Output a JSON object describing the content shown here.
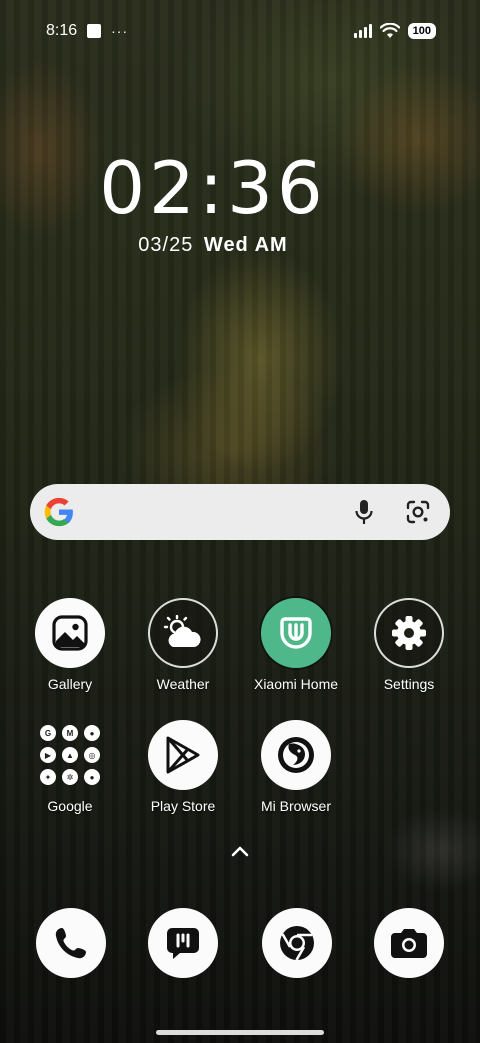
{
  "status_bar": {
    "time": "8:16",
    "more": "···",
    "battery": "100"
  },
  "clock": {
    "time": "02:36",
    "date": "03/25",
    "day": "Wed AM"
  },
  "search_bar": {
    "logo_icon": "google-g-icon",
    "mic_icon": "microphone-icon",
    "lens_icon": "google-lens-icon"
  },
  "apps": [
    {
      "label": "Gallery",
      "icon": "gallery-icon"
    },
    {
      "label": "Weather",
      "icon": "weather-icon"
    },
    {
      "label": "Xiaomi Home",
      "icon": "xiaomi-home-icon"
    },
    {
      "label": "Settings",
      "icon": "gear-icon"
    },
    {
      "label": "Google",
      "icon": "google-folder-icon"
    },
    {
      "label": "Play Store",
      "icon": "play-store-icon"
    },
    {
      "label": "Mi Browser",
      "icon": "mi-browser-icon"
    }
  ],
  "dock": [
    {
      "icon": "phone-icon"
    },
    {
      "icon": "messages-icon"
    },
    {
      "icon": "chrome-icon"
    },
    {
      "icon": "camera-icon"
    }
  ],
  "colors": {
    "xiaomi_green": "#4fb88a",
    "search_bg": "#ececec"
  }
}
